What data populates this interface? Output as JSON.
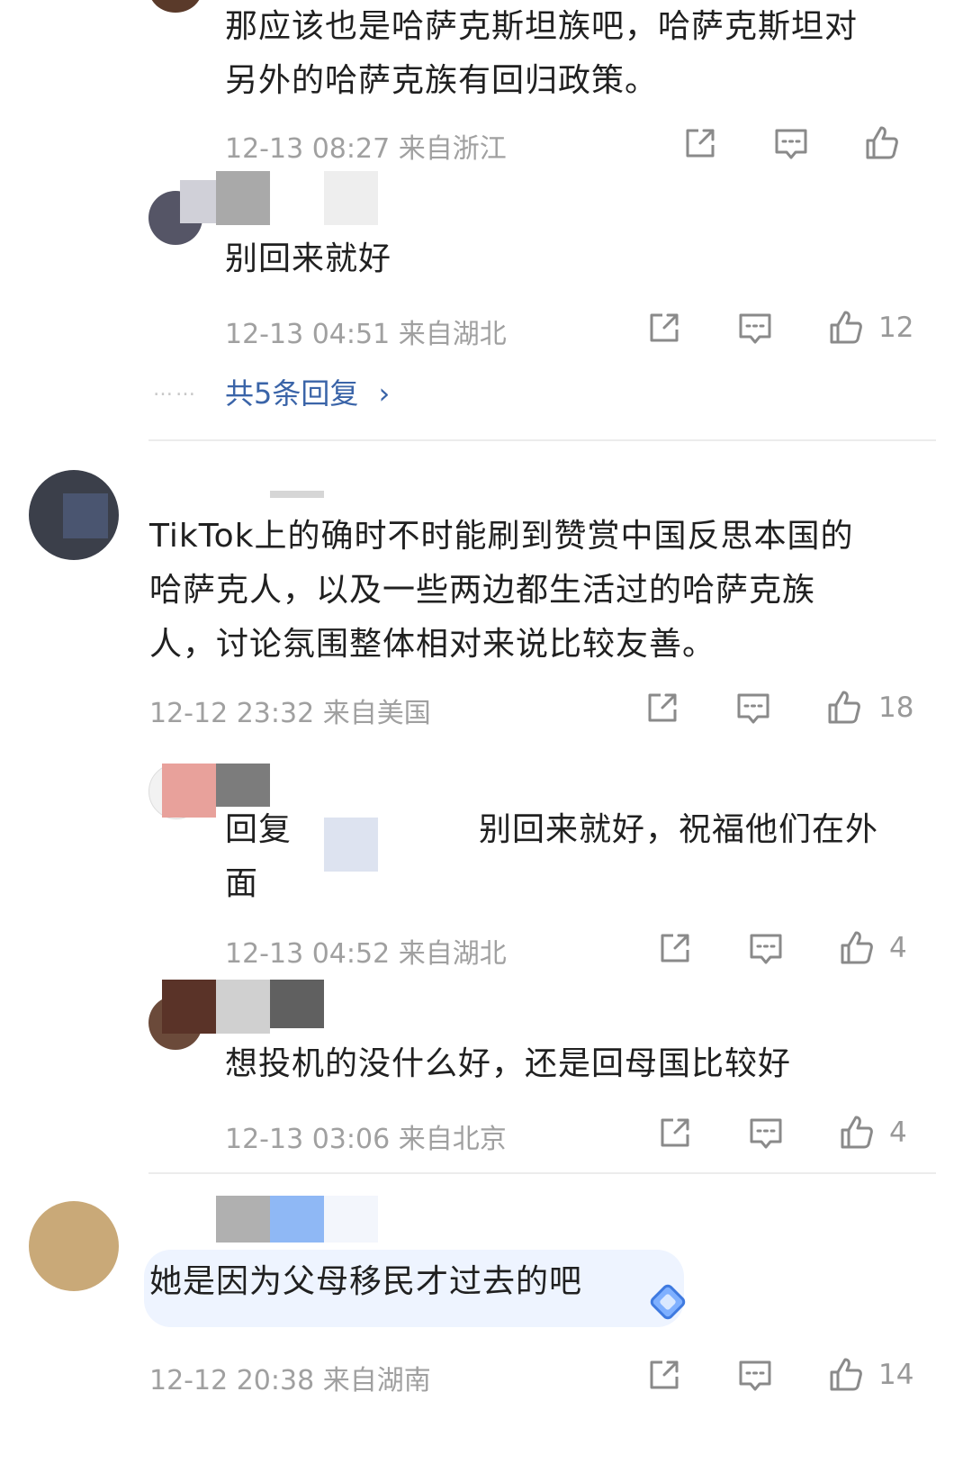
{
  "comments": [
    {
      "text_lines": [
        "那应该也是哈萨克斯坦族吧，哈萨克斯坦对",
        "另外的哈萨克族有回归政策。"
      ],
      "time": "12-13 08:27",
      "location": "来自浙江",
      "likes": ""
    },
    {
      "text_lines": [
        "别回来就好"
      ],
      "time": "12-13 04:51",
      "location": "来自湖北",
      "likes": "12",
      "more_replies": "共5条回复",
      "more_icon": "chevron-right-icon"
    },
    {
      "text_lines": [
        "TikTok上的确时不时能刷到赞赏中国反思本国的",
        "哈萨克人，以及一些两边都生活过的哈萨克族",
        "人，讨论氛围整体相对来说比较友善。"
      ],
      "time": "12-12 23:32",
      "location": "来自美国",
      "likes": "18"
    },
    {
      "reply_prefix": "回复",
      "text_lines_a": "别回来就好，祝福他们在外",
      "text_lines_b": "面",
      "time": "12-13 04:52",
      "location": "来自湖北",
      "likes": "4"
    },
    {
      "text_lines": [
        "想投机的没什么好，还是回母国比较好"
      ],
      "time": "12-13 03:06",
      "location": "来自北京",
      "likes": "4"
    },
    {
      "text_lines": [
        "她是因为父母移民才过去的吧"
      ],
      "time": "12-12 20:38",
      "location": "来自湖南",
      "likes": "14"
    }
  ],
  "icons": {
    "share": "share-icon",
    "comment": "comment-icon",
    "like": "thumbs-up-icon"
  },
  "colors": {
    "link": "#3a64a8",
    "meta": "#a0a0a0",
    "bubble": "#eef4ff"
  }
}
